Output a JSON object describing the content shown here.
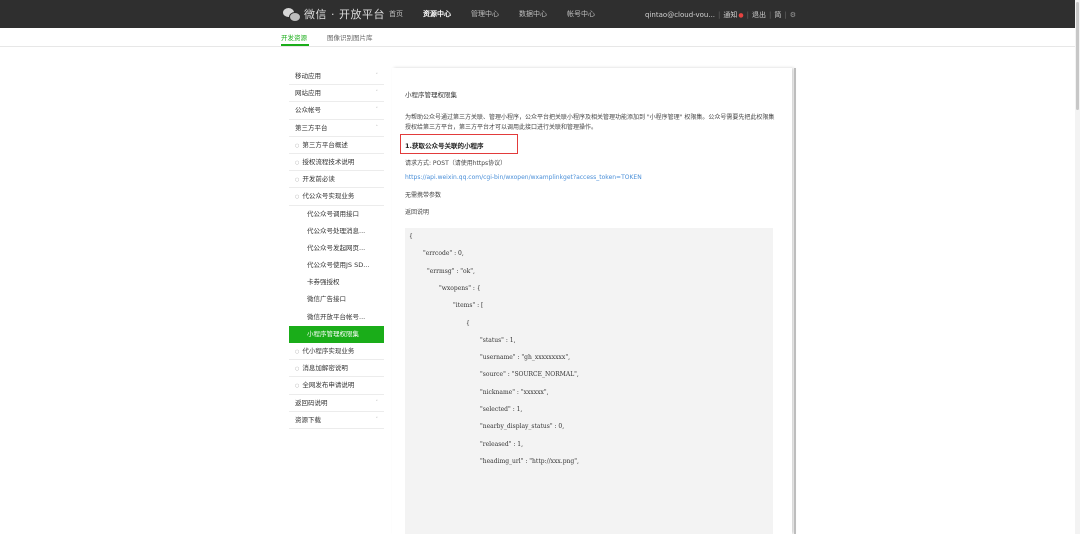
{
  "topbar": {
    "brand": "微信 · 开放平台",
    "nav": [
      "首页",
      "资源中心",
      "管理中心",
      "数据中心",
      "帐号中心"
    ],
    "nav_active": 1,
    "user": "qintao@cloud-vou...",
    "notice": "通知",
    "logout": "退出",
    "icon_text": "简"
  },
  "subnav": {
    "tabs": [
      "开发资源",
      "图像识别图片库"
    ],
    "active": 0
  },
  "sidebar": {
    "items": [
      {
        "label": "移动应用",
        "level": 0,
        "chev": "˅"
      },
      {
        "label": "网站应用",
        "level": 0,
        "chev": "˅"
      },
      {
        "label": "公众帐号",
        "level": 0,
        "chev": "˅"
      },
      {
        "label": "第三方平台",
        "level": 0,
        "chev": "˄"
      },
      {
        "label": "第三方平台概述",
        "level": 1
      },
      {
        "label": "授权流程技术说明",
        "level": 1
      },
      {
        "label": "开发前必读",
        "level": 1
      },
      {
        "label": "代公众号实现业务",
        "level": 1
      },
      {
        "label": "代公众号调用接口",
        "level": 2
      },
      {
        "label": "代公众号处理消息...",
        "level": 2
      },
      {
        "label": "代公众号发起网页...",
        "level": 2
      },
      {
        "label": "代公众号使用JS SD...",
        "level": 2
      },
      {
        "label": "卡券强授权",
        "level": 2
      },
      {
        "label": "微信广告接口",
        "level": 2
      },
      {
        "label": "微信开放平台帐号...",
        "level": 2
      },
      {
        "label": "小程序管理权限集",
        "level": 2,
        "current": true
      },
      {
        "label": "代小程序实现业务",
        "level": 1
      },
      {
        "label": "消息加解密说明",
        "level": 1
      },
      {
        "label": "全网发布申请说明",
        "level": 1
      },
      {
        "label": "返回码说明",
        "level": 0,
        "chev": "˅"
      },
      {
        "label": "资源下载",
        "level": 0,
        "chev": "˅"
      }
    ]
  },
  "content": {
    "title": "小程序管理权限集",
    "desc": "为帮助公众号通过第三方关联、管理小程序，公众平台把关联小程序及相关管理功能添加到 \"小程序管理\" 权限集。公众号需要先把此权限集授权给第三方平台，第三方平台才可以调用此接口进行关联和管理操作。",
    "h1": "1.获取公众号关联的小程序",
    "request": "请求方式: POST（请使用https协议）",
    "url": "https://api.weixin.qq.com/cgi-bin/wxopen/wxamplinkget?access_token=TOKEN",
    "no_params": "无需携带参数",
    "return_note": "返回说明",
    "code_lines": [
      "{",
      "\"errcode\" : 0,",
      "\"errmsg\" : \"ok\",",
      "\"wxopens\" : {",
      "\"items\" : [",
      "{",
      "\"status\" : 1,",
      "\"username\" : \"gh_xxxxxxxxx\",",
      "\"source\" : \"SOURCE_NORMAL\",",
      "\"nickname\" : \"xxxxxx\",",
      "\"selected\" : 1,",
      "\"nearby_display_status\" : 0,",
      "\"released\" : 1,",
      "\"headimg_url\" : \"http://xxx.png\","
    ]
  }
}
